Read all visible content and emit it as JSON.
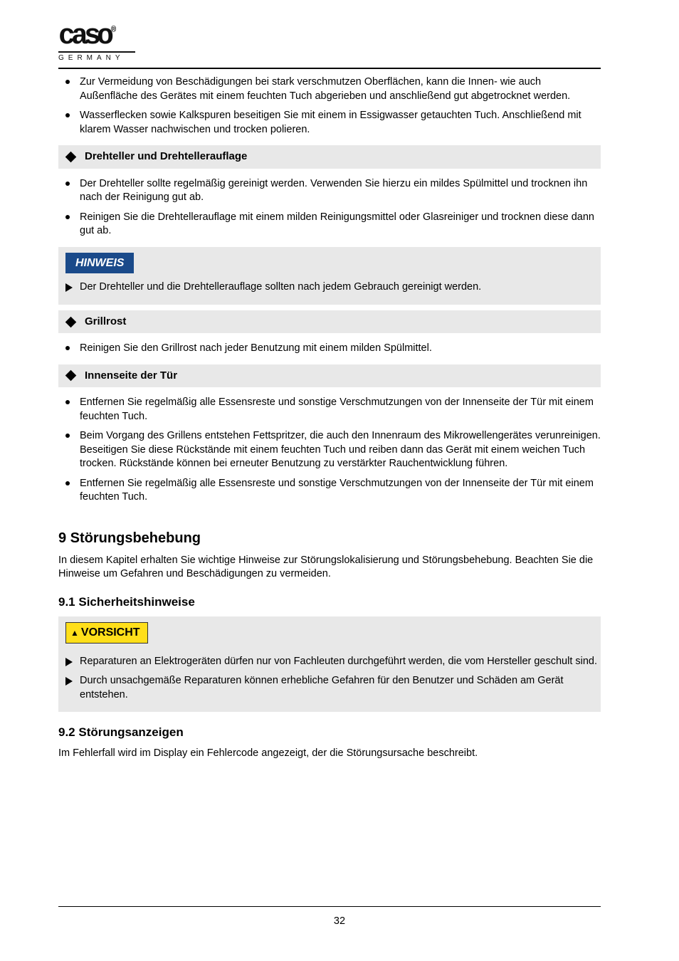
{
  "logo": {
    "brand_top": "caso",
    "brand_reg": "®",
    "brand_bottom": "GERMANY"
  },
  "top_bullets": [
    "Zur Vermeidung von Beschädigungen bei stark verschmutzen Oberflächen, kann die Innen- wie auch Außenfläche des Gerätes mit einem feuchten Tuch abgerieben und anschließend gut abgetrocknet werden.",
    "Wasserflecken sowie Kalkspuren beseitigen Sie mit einem in Essigwasser getauchten Tuch. Anschließend mit klarem Wasser nachwischen und trocken polieren."
  ],
  "section1": {
    "title": "Drehteller und Drehtellerauflage",
    "bullets": [
      "Der Drehteller sollte regelmäßig gereinigt werden. Verwenden Sie hierzu ein mildes Spülmittel und trocknen ihn nach der Reinigung gut ab.",
      "Reinigen Sie die Drehtellerauflage mit einem milden Reinigungsmittel oder Glasreiniger und trocknen diese dann gut ab."
    ],
    "hinweis_label": "HINWEIS",
    "hinweis_points": [
      "Der Drehteller und die Drehtellerauflage sollten nach jedem Gebrauch gereinigt werden."
    ]
  },
  "section2": {
    "title": "Grillrost",
    "bullets": [
      "Reinigen Sie den Grillrost nach jeder Benutzung mit einem milden Spülmittel."
    ]
  },
  "section3": {
    "title": "Innenseite der Tür",
    "bullets": [
      "Entfernen Sie regelmäßig alle Essensreste und sonstige Verschmutzungen von der Innenseite der Tür mit einem feuchten Tuch.",
      "Beim Vorgang des Grillens entstehen Fettspritzer, die auch den Innenraum des Mikrowellengerätes verunreinigen. Beseitigen Sie diese Rückstände mit einem feuchten Tuch und reiben dann das Gerät mit einem weichen Tuch trocken. Rückstände können bei erneuter Benutzung zu verstärkter Rauchentwicklung führen.",
      "Entfernen Sie regelmäßig alle Essensreste und sonstige Verschmutzungen von der Innenseite der Tür mit einem feuchten Tuch."
    ]
  },
  "h2": "9    Störungsbehebung",
  "p1": "In diesem Kapitel erhalten Sie wichtige Hinweise zur Störungslokalisierung und Störungsbehebung. Beachten Sie die Hinweise um Gefahren und Beschädigungen zu vermeiden.",
  "h3": "9.1   Sicherheitshinweise",
  "vorsicht_label": "VORSICHT",
  "vorsicht_points": [
    "Reparaturen an Elektrogeräten dürfen nur von Fachleuten durchgeführt werden, die vom Hersteller geschult sind.",
    "Durch unsachgemäße Reparaturen können erhebliche Gefahren für den Benutzer und Schäden am Gerät entstehen."
  ],
  "h4": "9.2   Störungsanzeigen",
  "p2": "Im Fehlerfall wird im Display ein Fehlercode angezeigt, der die Störungsursache beschreibt.",
  "page_number": "32"
}
